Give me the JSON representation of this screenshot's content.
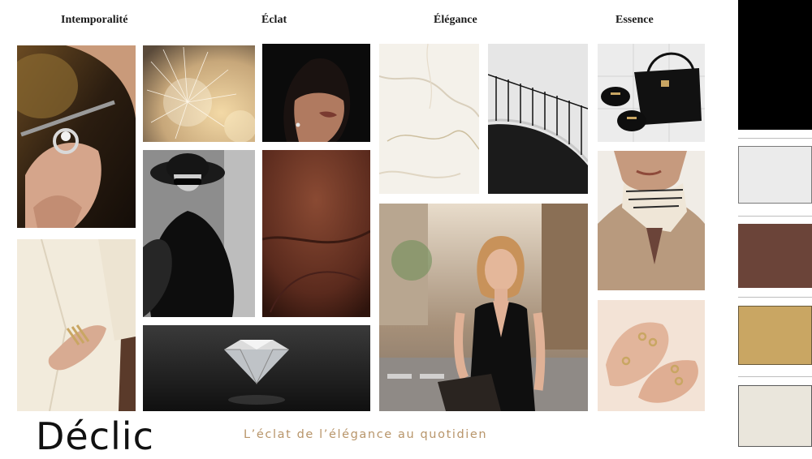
{
  "headings": {
    "col1": "Intemporalité",
    "col2": "Éclat",
    "col3": "Élégance",
    "col4": "Essence"
  },
  "brand": {
    "name": "Déclic",
    "tagline": "L’éclat de l’élégance au quotidien"
  },
  "palette": [
    {
      "name": "black",
      "color": "#000000"
    },
    {
      "name": "light-gray",
      "color": "#ebebeb"
    },
    {
      "name": "brown",
      "color": "#6b4439"
    },
    {
      "name": "gold",
      "color": "#c9a663"
    },
    {
      "name": "cream",
      "color": "#eae6dc"
    }
  ],
  "photos": [
    "jeweler-hands-ring-photo",
    "dandelion-seeds-photo",
    "woman-shadow-earring-photo",
    "marble-texture-photo",
    "spiral-staircase-photo",
    "black-bag-loafers-photo",
    "woman-hat-sunglasses-photo",
    "brown-leather-texture-photo",
    "woman-silk-scarf-photo",
    "cream-suit-bracelets-photo",
    "woman-black-dress-street-photo",
    "hands-gold-rings-photo",
    "diamond-photo"
  ]
}
